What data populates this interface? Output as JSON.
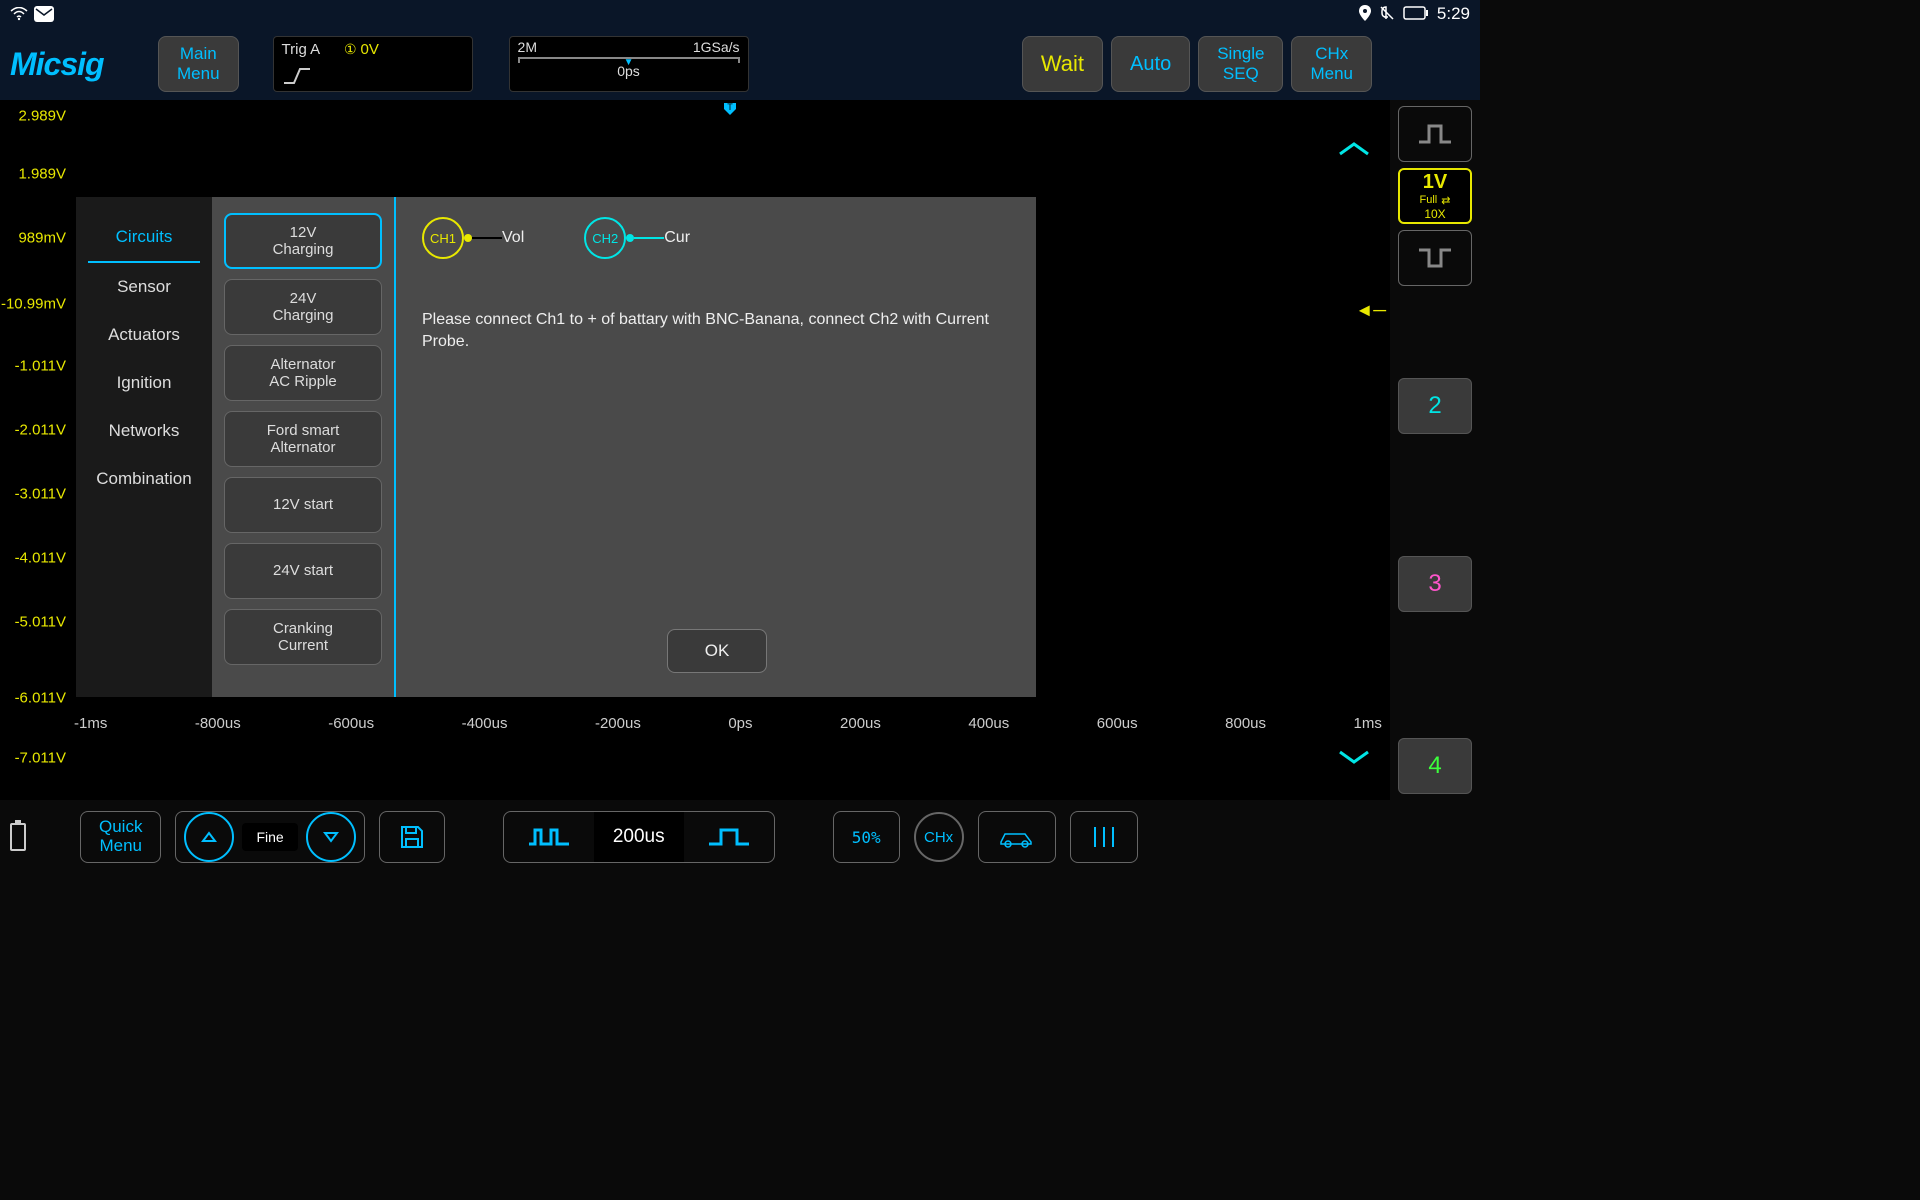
{
  "status": {
    "time": "5:29"
  },
  "logo": "Micsig",
  "toolbar": {
    "main_menu_l1": "Main",
    "main_menu_l2": "Menu",
    "trig_label": "Trig A",
    "trig_ch": "①",
    "trig_val": "0V",
    "tb_mem": "2M",
    "tb_rate": "1GSa/s",
    "tb_time": "0ps",
    "wait": "Wait",
    "auto": "Auto",
    "single_l1": "Single",
    "single_l2": "SEQ",
    "chx_l1": "CHx",
    "chx_l2": "Menu"
  },
  "yaxis": [
    "2.989V",
    "1.989V",
    "989mV",
    "-10.99mV",
    "-1.011V",
    "-2.011V",
    "-3.011V",
    "-4.011V",
    "-5.011V",
    "-6.011V",
    "-7.011V"
  ],
  "xaxis": [
    "-1ms",
    "-800us",
    "-600us",
    "-400us",
    "-200us",
    "0ps",
    "200us",
    "400us",
    "600us",
    "800us",
    "1ms"
  ],
  "sidebar": {
    "vdiv": "1V",
    "full": "Full",
    "probe": "10X",
    "ch2": "2",
    "ch3": "3",
    "ch4": "4"
  },
  "modal": {
    "tabs": [
      "Circuits",
      "Sensor",
      "Actuators",
      "Ignition",
      "Networks",
      "Combination"
    ],
    "options": [
      "12V\nCharging",
      "24V\nCharging",
      "Alternator\nAC Ripple",
      "Ford smart\nAlternator",
      "12V start",
      "24V start",
      "Cranking\nCurrent"
    ],
    "ch1_label": "CH1",
    "ch1_name": "Vol",
    "ch2_label": "CH2",
    "ch2_name": "Cur",
    "instruction": "Please connect Ch1 to + of battary with BNC-Banana, connect Ch2 with Current Probe.",
    "ok": "OK"
  },
  "bottom": {
    "quick_l1": "Quick",
    "quick_l2": "Menu",
    "fine": "Fine",
    "timebase": "200us",
    "fifty": "50%",
    "chx": "CHx"
  }
}
